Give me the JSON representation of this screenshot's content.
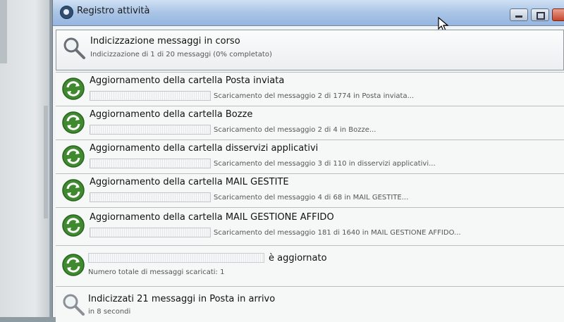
{
  "window": {
    "title": "Registro attività"
  },
  "activities": [
    {
      "kind": "search",
      "title": "Indicizzazione messaggi in corso",
      "subtitle": "Indicizzazione di 1 di 20 messaggi (0% completato)"
    },
    {
      "kind": "sync",
      "title": "Aggiornamento della cartella Posta inviata",
      "detail": "Scaricamento del messaggio 2 di 1774 in Posta inviata..."
    },
    {
      "kind": "sync",
      "title": "Aggiornamento della cartella Bozze",
      "detail": "Scaricamento del messaggio 2 di 4 in Bozze..."
    },
    {
      "kind": "sync",
      "title": "Aggiornamento della cartella disservizi applicativi",
      "detail": "Scaricamento del messaggio 3 di 110 in disservizi applicativi..."
    },
    {
      "kind": "sync",
      "title": "Aggiornamento della cartella MAIL GESTITE",
      "detail": "Scaricamento del messaggio 4 di 68 in MAIL GESTITE..."
    },
    {
      "kind": "sync",
      "title": "Aggiornamento della cartella MAIL GESTIONE AFFIDO",
      "detail": "Scaricamento del messaggio 181 di 1640 in MAIL GESTIONE AFFIDO..."
    },
    {
      "kind": "sync",
      "title": "è aggiornato",
      "subtitle": "Numero totale di messaggi scaricati: 1"
    },
    {
      "kind": "search",
      "title": "Indicizzati 21 messaggi in Posta in arrivo",
      "subtitle": "in 8 secondi"
    }
  ]
}
